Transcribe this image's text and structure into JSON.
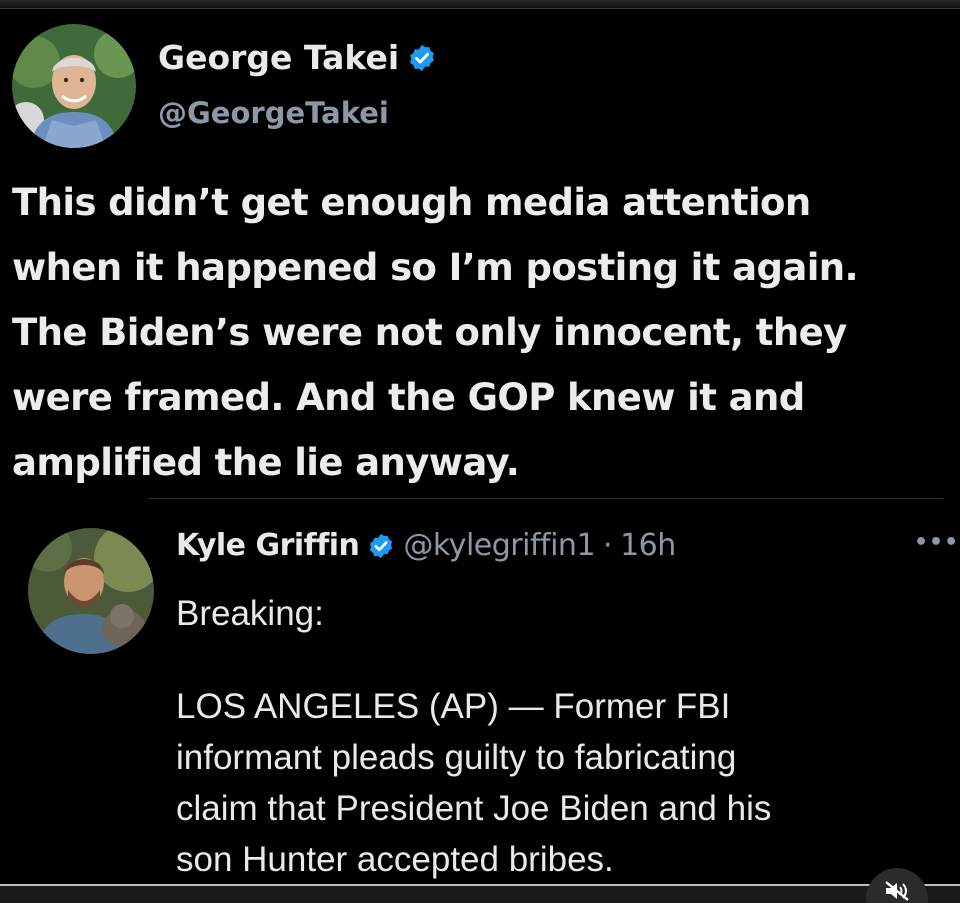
{
  "tweet": {
    "author_name": "George Takei",
    "author_handle": "@GeorgeTakei",
    "verified": true,
    "text_lines": [
      "This didn’t get enough media attention",
      "when it happened so I’m posting it again.",
      "The Biden’s were not only innocent, they",
      "were framed. And the GOP knew it and",
      "amplified the lie anyway."
    ]
  },
  "quoted_tweet": {
    "author_name": "Kyle Griffin",
    "author_handle": "@kylegriffin1",
    "separator": "·",
    "time": "16h",
    "verified": true,
    "more_icon": "more-horizontal-icon",
    "lead": "Breaking:",
    "text_lines": [
      "LOS ANGELES (AP) — Former FBI",
      "informant pleads guilty to fabricating",
      "claim that President Joe Biden and his",
      "son Hunter accepted bribes."
    ]
  },
  "overlay": {
    "icon": "speaker-muted-icon"
  },
  "colors": {
    "background": "#000000",
    "text": "#e7e9ea",
    "secondary_text": "#8b98a5",
    "verified_badge": "#1d9bf0",
    "divider": "#2f3336"
  }
}
